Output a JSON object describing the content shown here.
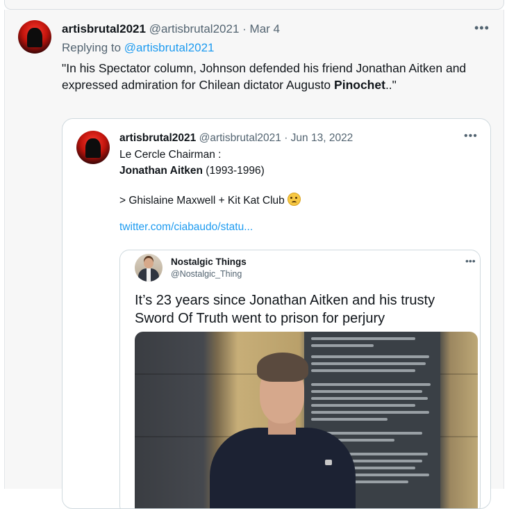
{
  "main_tweet": {
    "author_name": "artisbrutal2021",
    "handle": "@artisbrutal2021",
    "separator": "·",
    "date": "Mar 4",
    "more_label": "•••",
    "replying_prefix": "Replying to",
    "replying_handle": "@artisbrutal2021",
    "text_before": "\"In his Spectator column, Johnson defended his friend Jonathan Aitken and expressed admiration for Chilean dictator Augusto ",
    "text_bold": "Pinochet",
    "text_after": "..\""
  },
  "quoted_tweet": {
    "author_name": "artisbrutal2021",
    "handle": "@artisbrutal2021",
    "separator": "·",
    "date": "Jun 13, 2022",
    "more_label": "•••",
    "line1": "Le Cercle Chairman :",
    "line2_bold": "Jonathan Aitken",
    "line2_rest": " (1993-1996)",
    "line3": "> Ghislaine Maxwell + Kit Kat Club ",
    "emoji_icon": "slightly-frowning-face-icon",
    "link": "twitter.com/ciabaudo/statu..."
  },
  "embedded_card": {
    "author_name": "Nostalgic Things",
    "handle": "@Nostalgic_Thing",
    "more_label": "•••",
    "headline": "It’s 23 years since Jonathan Aitken and his trusty Sword Of Truth went to prison for perjury"
  },
  "colors": {
    "link": "#1d9bf0",
    "secondary_text": "#536471",
    "primary_text": "#0f1419",
    "border": "#cfd9de",
    "tweet_bg": "#f7f7f7"
  }
}
